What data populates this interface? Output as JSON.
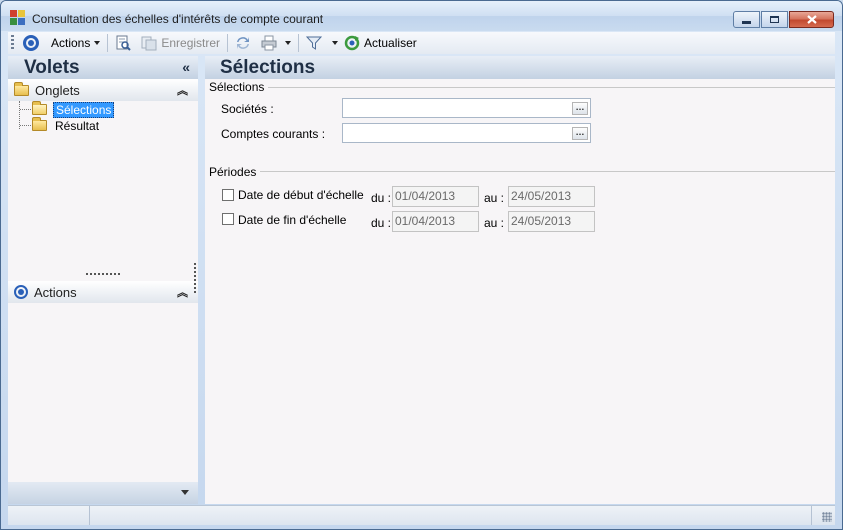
{
  "window": {
    "title": "Consultation des échelles d'intérêts de compte courant"
  },
  "toolbar": {
    "actions_label": "Actions",
    "save_label": "Enregistrer",
    "refresh_label": "Actualiser"
  },
  "left_panel": {
    "title": "Volets",
    "collapse_glyph": "«",
    "onglets": {
      "label": "Onglets",
      "items": [
        {
          "label": "Sélections",
          "selected": true
        },
        {
          "label": "Résultat",
          "selected": false
        }
      ]
    },
    "actions": {
      "label": "Actions"
    }
  },
  "content": {
    "title": "Sélections",
    "selections_group": {
      "label": "Sélections",
      "societes_label": "Sociétés :",
      "societes_value": "",
      "comptes_label": "Comptes courants :",
      "comptes_value": ""
    },
    "periodes_group": {
      "label": "Périodes",
      "rows": [
        {
          "label": "Date de début d'échelle",
          "checked": false,
          "du_label": "du :",
          "du_value": "01/04/2013",
          "au_label": "au :",
          "au_value": "24/05/2013"
        },
        {
          "label": "Date de fin d'échelle",
          "checked": false,
          "du_label": "du :",
          "du_value": "01/04/2013",
          "au_label": "au :",
          "au_value": "24/05/2013"
        }
      ]
    }
  },
  "colors": {
    "accent": "#2a60b8",
    "selection": "#3399ff",
    "panel_background": "#f7f5f7"
  }
}
